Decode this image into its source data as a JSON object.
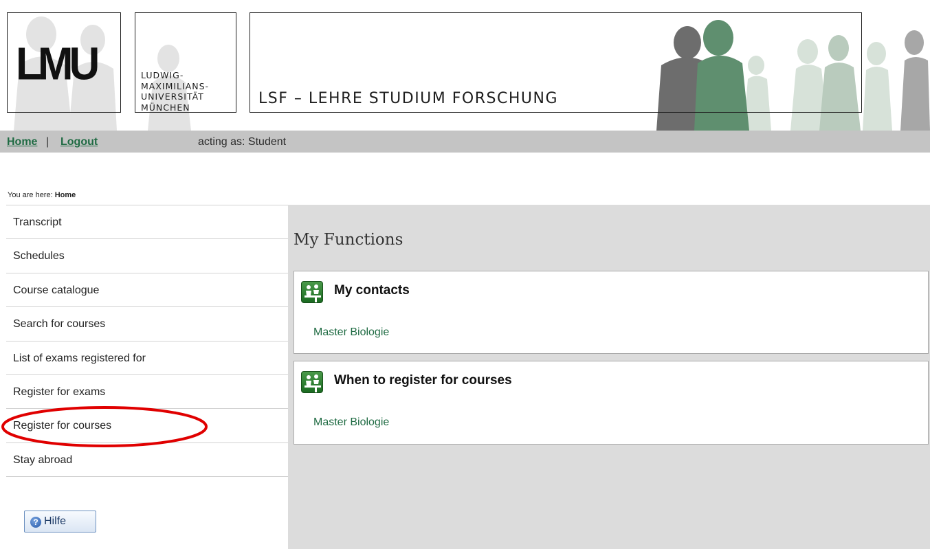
{
  "header": {
    "logo_text": "LMU",
    "university_name": "LUDWIG-\nMAXIMILIANS-\nUNIVERSITÄT\nMÜNCHEN",
    "app_title": "LSF – LEHRE STUDIUM FORSCHUNG"
  },
  "nav": {
    "home_label": "Home",
    "separator": "|",
    "logout_label": "Logout",
    "role_text": "acting as: Student"
  },
  "breadcrumb": {
    "prefix": "You are here:",
    "current": "Home"
  },
  "sidebar": {
    "items": [
      {
        "label": "Transcript"
      },
      {
        "label": "Schedules"
      },
      {
        "label": "Course catalogue"
      },
      {
        "label": "Search for courses"
      },
      {
        "label": "List of exams registered for"
      },
      {
        "label": "Register for exams"
      },
      {
        "label": "Register for courses"
      },
      {
        "label": "Stay abroad"
      }
    ],
    "help_button_label": "Hilfe"
  },
  "main": {
    "title": "My Functions",
    "cards": [
      {
        "title": "My contacts",
        "link": "Master Biologie"
      },
      {
        "title": "When to register for courses",
        "link": "Master Biologie"
      }
    ]
  },
  "colors": {
    "link_green": "#1f6b43",
    "nav_bar": "#c4c4c4",
    "main_panel": "#dcdcdc",
    "annotation_red": "#e00000"
  }
}
